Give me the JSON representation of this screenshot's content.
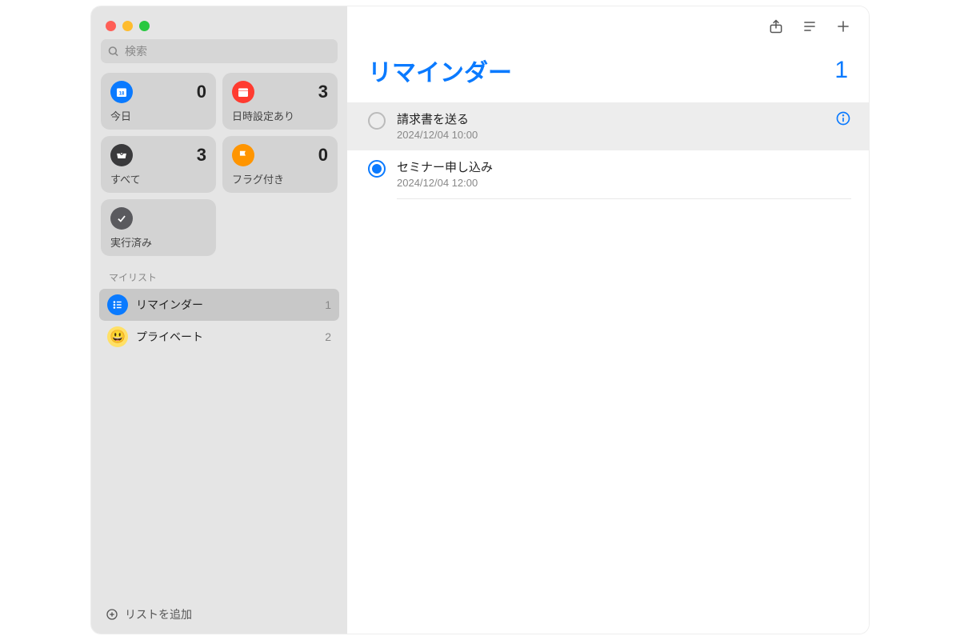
{
  "search": {
    "placeholder": "検索"
  },
  "smart": {
    "today": {
      "label": "今日",
      "count": 0
    },
    "scheduled": {
      "label": "日時設定あり",
      "count": 3
    },
    "all": {
      "label": "すべて",
      "count": 3
    },
    "flagged": {
      "label": "フラグ付き",
      "count": 0
    },
    "completed": {
      "label": "実行済み"
    }
  },
  "sidebar": {
    "section_label": "マイリスト",
    "items": [
      {
        "name": "リマインダー",
        "count": 1,
        "icon": "list-blue",
        "selected": true
      },
      {
        "name": "プライベート",
        "count": 2,
        "icon": "emoji-smile",
        "selected": false
      }
    ],
    "add_list_label": "リストを追加"
  },
  "main": {
    "title": "リマインダー",
    "count": 1,
    "reminders": [
      {
        "title": "請求書を送る",
        "date": "2024/12/04 10:00",
        "completed": false,
        "selected": true
      },
      {
        "title": "セミナー申し込み",
        "date": "2024/12/04 12:00",
        "completed": false,
        "selected": false,
        "highlighted": true
      }
    ]
  }
}
